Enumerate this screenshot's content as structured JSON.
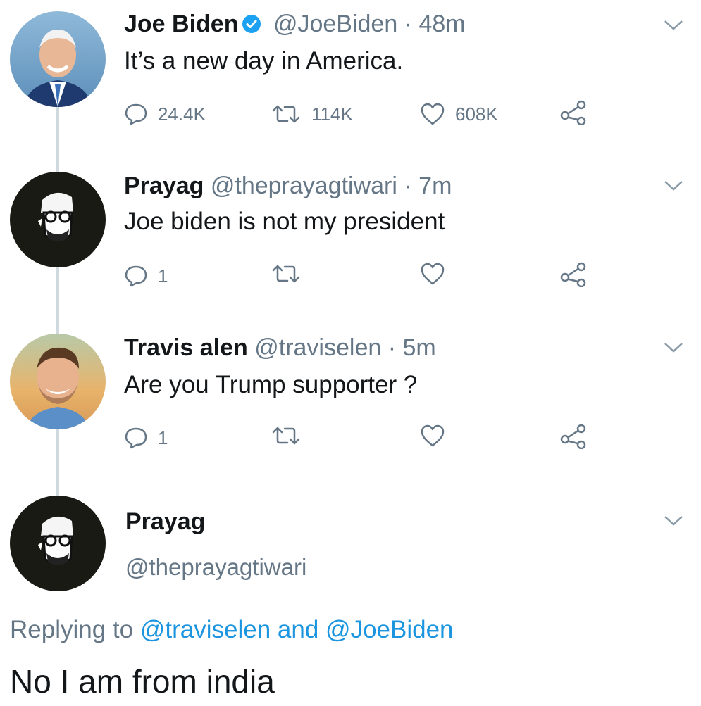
{
  "tweets": [
    {
      "name": "Joe Biden",
      "handle": "@JoeBiden",
      "separator": "·",
      "time": "48m",
      "text": "It’s a new day in America.",
      "replies": "24.4K",
      "retweets": "114K",
      "likes": "608K",
      "verified": true
    },
    {
      "name": "Prayag",
      "handle": "@theprayagtiwari",
      "separator": "·",
      "time": "7m",
      "text": "Joe biden is not my president",
      "replies": "1",
      "retweets": "",
      "likes": ""
    },
    {
      "name": "Travis alen",
      "handle": "@traviselen",
      "separator": "·",
      "time": "5m",
      "text": "Are you Trump supporter ?",
      "replies": "1",
      "retweets": "",
      "likes": ""
    }
  ],
  "focused_tweet": {
    "name": "Prayag",
    "handle": "@theprayagtiwari",
    "replying_prefix": "Replying to",
    "replying_user1": "@traviselen",
    "replying_and": "and",
    "replying_user2": "@JoeBiden",
    "text": "No I am from india"
  },
  "colors": {
    "accent": "#1b95e0",
    "secondary_text": "#657786",
    "thread_line": "#cfd9de"
  },
  "icons": [
    "verified-badge-icon",
    "reply-icon",
    "retweet-icon",
    "like-icon",
    "share-icon",
    "chevron-down-icon"
  ]
}
